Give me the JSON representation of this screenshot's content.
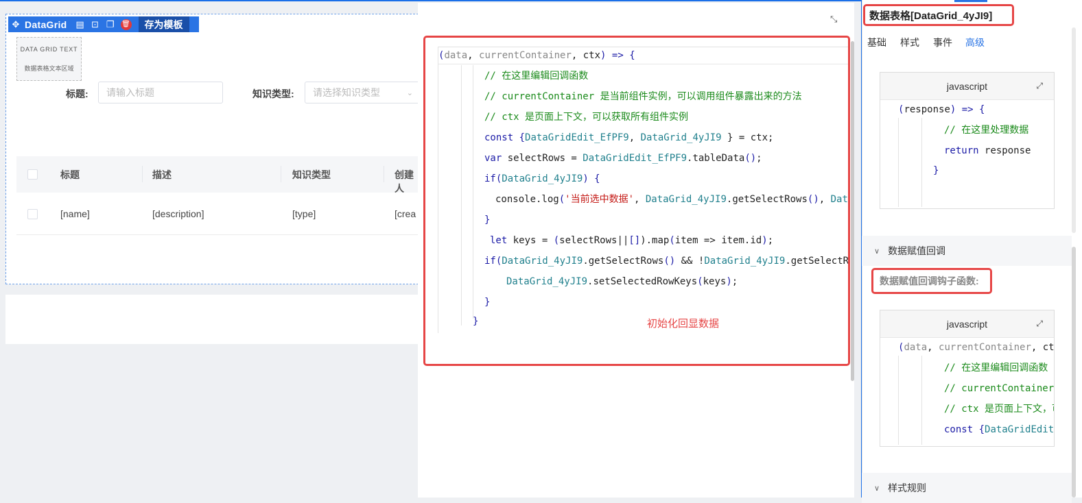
{
  "toolbar": {
    "component_name": "DataGrid",
    "save_template": "存为模板",
    "icons": [
      "move-icon",
      "doc-icon",
      "terminal-icon",
      "copy-icon",
      "delete-icon"
    ]
  },
  "text_area": {
    "title": "DATA GRID TEXT",
    "subtitle": "数据表格文本区域"
  },
  "search_form": {
    "title_label": "标题:",
    "title_placeholder": "请输入标题",
    "type_label": "知识类型:",
    "type_placeholder": "请选择知识类型"
  },
  "table": {
    "headers": [
      "标题",
      "描述",
      "知识类型",
      "创建人"
    ],
    "rows": [
      [
        "[name]",
        "[description]",
        "[type]",
        "[crea"
      ]
    ]
  },
  "editor": {
    "lines": [
      [
        {
          "t": "(",
          "c": "p"
        },
        {
          "t": "data",
          "c": "gray"
        },
        {
          "t": ", ",
          "c": ""
        },
        {
          "t": "currentContainer",
          "c": "gray"
        },
        {
          "t": ", ",
          "c": ""
        },
        {
          "t": "ctx",
          "c": ""
        },
        {
          "t": ") => ",
          "c": "p"
        },
        {
          "t": "{",
          "c": "p"
        }
      ],
      [
        {
          "t": "// 在这里编辑回调函数",
          "c": "cm"
        }
      ],
      [
        {
          "t": "// currentContainer 是当前组件实例，可以调用组件暴露出来的方法",
          "c": "cm"
        }
      ],
      [
        {
          "t": "// ctx 是页面上下文，可以获取所有组件实例",
          "c": "cm"
        }
      ],
      [
        {
          "t": "const ",
          "c": "k"
        },
        {
          "t": "{",
          "c": "p"
        },
        {
          "t": "DataGridEdit_EfPF9",
          "c": "fn"
        },
        {
          "t": ", ",
          "c": ""
        },
        {
          "t": "DataGrid_4yJI9",
          "c": "fn"
        },
        {
          "t": " } = ctx;",
          "c": ""
        }
      ],
      [
        {
          "t": "var ",
          "c": "k"
        },
        {
          "t": "selectRows = ",
          "c": ""
        },
        {
          "t": "DataGridEdit_EfPF9",
          "c": "fn"
        },
        {
          "t": ".tableData",
          "c": ""
        },
        {
          "t": "()",
          "c": "p"
        },
        {
          "t": ";",
          "c": ""
        }
      ],
      [
        {
          "t": "if",
          "c": "k"
        },
        {
          "t": "(",
          "c": "p"
        },
        {
          "t": "DataGrid_4yJI9",
          "c": "fn"
        },
        {
          "t": ") {",
          "c": "p"
        }
      ],
      [
        {
          "t": "console.log",
          "c": ""
        },
        {
          "t": "(",
          "c": "p"
        },
        {
          "t": "'当前选中数据'",
          "c": "str"
        },
        {
          "t": ", ",
          "c": ""
        },
        {
          "t": "DataGrid_4yJI9",
          "c": "fn"
        },
        {
          "t": ".getSelectRows",
          "c": ""
        },
        {
          "t": "()",
          "c": "p"
        },
        {
          "t": ", ",
          "c": ""
        },
        {
          "t": "DataG",
          "c": "fn"
        }
      ],
      [
        {
          "t": "}",
          "c": "p"
        }
      ],
      [
        {
          "t": "let ",
          "c": "k"
        },
        {
          "t": "keys = ",
          "c": ""
        },
        {
          "t": "(",
          "c": "p"
        },
        {
          "t": "selectRows||",
          "c": ""
        },
        {
          "t": "[]",
          "c": "p"
        },
        {
          "t": ").map",
          "c": ""
        },
        {
          "t": "(",
          "c": "p"
        },
        {
          "t": "item => item.id",
          "c": ""
        },
        {
          "t": ")",
          "c": "p"
        },
        {
          "t": ";",
          "c": ""
        }
      ],
      [
        {
          "t": "if",
          "c": "k"
        },
        {
          "t": "(",
          "c": "p"
        },
        {
          "t": "DataGrid_4yJI9",
          "c": "fn"
        },
        {
          "t": ".getSelectRows",
          "c": ""
        },
        {
          "t": "()",
          "c": "p"
        },
        {
          "t": " && !",
          "c": ""
        },
        {
          "t": "DataGrid_4yJI9",
          "c": "fn"
        },
        {
          "t": ".getSelectRow",
          "c": ""
        }
      ],
      [
        {
          "t": "DataGrid_4yJI9",
          "c": "fn"
        },
        {
          "t": ".setSelectedRowKeys",
          "c": ""
        },
        {
          "t": "(",
          "c": "p"
        },
        {
          "t": "keys",
          "c": ""
        },
        {
          "t": ")",
          "c": "p"
        },
        {
          "t": ";",
          "c": ""
        }
      ],
      [
        {
          "t": "}",
          "c": "p"
        }
      ],
      [
        {
          "t": "}",
          "c": "p"
        }
      ]
    ],
    "annotation": "初始化回显数据"
  },
  "right_panel": {
    "title": "数据表格[DataGrid_4yJI9]",
    "tabs": [
      "基础",
      "样式",
      "事件",
      "高级"
    ],
    "active_tab": "高级",
    "editor1": {
      "language": "javascript",
      "lines": [
        [
          {
            "t": "(",
            "c": "p"
          },
          {
            "t": "response",
            "c": ""
          },
          {
            "t": ") => ",
            "c": "p"
          },
          {
            "t": "{",
            "c": "p"
          }
        ],
        [
          {
            "t": "// 在这里处理数据",
            "c": "cm"
          }
        ],
        [
          {
            "t": "return ",
            "c": "k"
          },
          {
            "t": "response",
            "c": ""
          }
        ],
        [
          {
            "t": "}",
            "c": "p"
          }
        ]
      ]
    },
    "section_callback": "数据赋值回调",
    "hook_label": "数据赋值回调钩子函数:",
    "editor2": {
      "language": "javascript",
      "lines": [
        [
          {
            "t": "(",
            "c": "p"
          },
          {
            "t": "data",
            "c": "gray"
          },
          {
            "t": ", ",
            "c": ""
          },
          {
            "t": "currentContainer",
            "c": "gray"
          },
          {
            "t": ", ",
            "c": ""
          },
          {
            "t": "ct",
            "c": ""
          }
        ],
        [
          {
            "t": "// 在这里编辑回调函数",
            "c": "cm"
          }
        ],
        [
          {
            "t": "// currentContainer",
            "c": "cm"
          }
        ],
        [
          {
            "t": "// ctx 是页面上下文，可",
            "c": "cm"
          }
        ],
        [
          {
            "t": "const ",
            "c": "k"
          },
          {
            "t": "{",
            "c": "p"
          },
          {
            "t": "DataGridEdit",
            "c": "fn"
          }
        ]
      ]
    },
    "section_style_rules": "样式规则"
  },
  "colors": {
    "accent": "#2a74e4",
    "highlight": "#e64545"
  }
}
